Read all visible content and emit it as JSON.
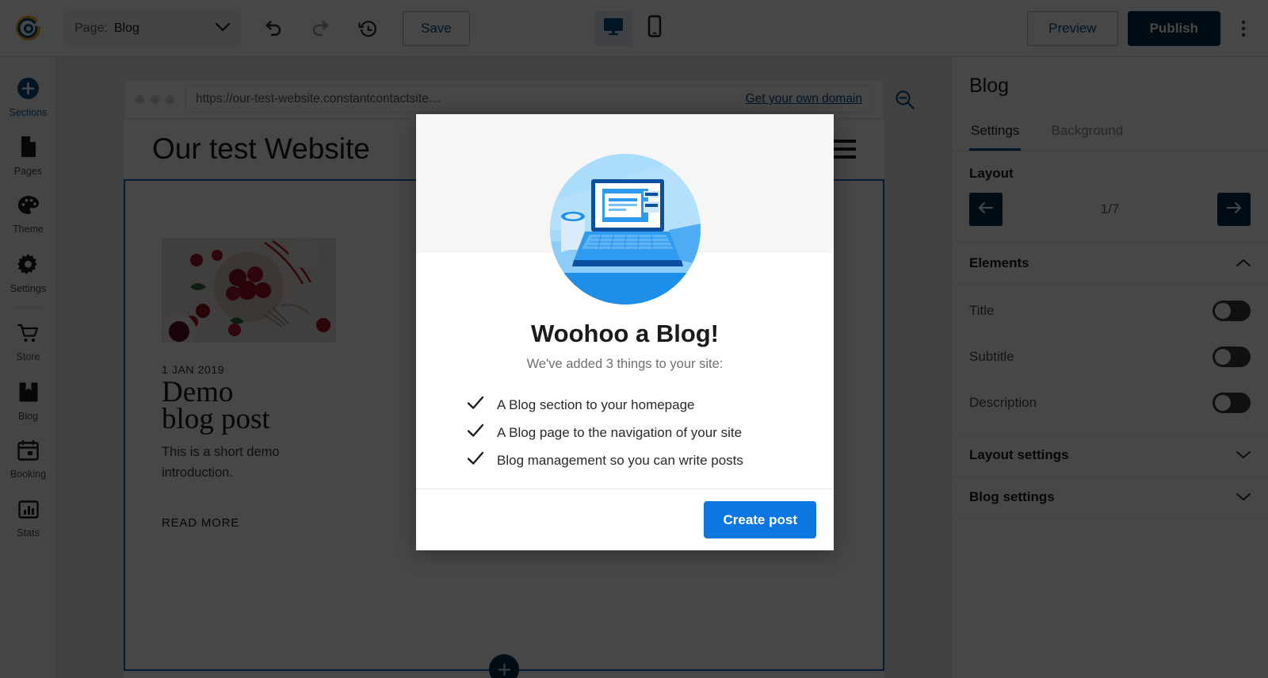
{
  "toolbar": {
    "logo_icon": "constant-contact-logo",
    "page_label": "Page:",
    "page_value": "Blog",
    "undo_icon": "undo-icon",
    "redo_icon": "redo-icon",
    "history_icon": "history-clock-icon",
    "save_label": "Save",
    "desktop_icon": "desktop-monitor-icon",
    "mobile_icon": "mobile-phone-icon",
    "preview_label": "Preview",
    "publish_label": "Publish",
    "kebab_icon": "more-options-icon"
  },
  "sidebar": {
    "items": [
      {
        "label": "Sections",
        "icon": "plus-circle-icon",
        "active": true
      },
      {
        "label": "Pages",
        "icon": "page-document-icon",
        "active": false
      },
      {
        "label": "Theme",
        "icon": "palette-icon",
        "active": false
      },
      {
        "label": "Settings",
        "icon": "gear-icon",
        "active": false
      },
      {
        "label": "Store",
        "icon": "shopping-cart-icon",
        "active": false
      },
      {
        "label": "Blog",
        "icon": "bookmark-book-icon",
        "active": false
      },
      {
        "label": "Booking",
        "icon": "calendar-icon",
        "active": false
      },
      {
        "label": "Stats",
        "icon": "bar-chart-icon",
        "active": false
      }
    ]
  },
  "canvas": {
    "browser": {
      "url": "https://our-test-website.constantcontactsite…",
      "domain_link": "Get your own domain",
      "zoom_icon": "zoom-out-magnifier-icon"
    },
    "site": {
      "title": "Our test Website",
      "menu_icon": "hamburger-menu-icon",
      "prev_arrow_icon": "chevron-left-icon",
      "next_arrow_icon": "chevron-right-icon",
      "posts": [
        {
          "date": "1 JAN 2019",
          "title_line1": "Demo",
          "title_line2": "blog post",
          "excerpt": "This is a short demo introduction.",
          "read_more": "READ MORE"
        }
      ]
    }
  },
  "right_panel": {
    "title": "Blog",
    "tabs": [
      {
        "label": "Settings",
        "active": true
      },
      {
        "label": "Background",
        "active": false
      }
    ],
    "layout": {
      "heading": "Layout",
      "value": "1/7",
      "prev_icon": "arrow-left-icon",
      "next_icon": "arrow-right-icon"
    },
    "elements": {
      "heading": "Elements",
      "collapse_icon": "chevron-up-icon",
      "rows": [
        {
          "label": "Title",
          "on": false
        },
        {
          "label": "Subtitle",
          "on": false
        },
        {
          "label": "Description",
          "on": false
        }
      ]
    },
    "sections": [
      {
        "label": "Layout settings",
        "icon": "chevron-down-icon"
      },
      {
        "label": "Blog settings",
        "icon": "chevron-down-icon"
      }
    ]
  },
  "modal": {
    "close_icon": "close-x-icon",
    "illustration": "laptop-with-coffee-illustration",
    "heading": "Woohoo a Blog!",
    "subheading": "We've added 3 things to your site:",
    "items": [
      "A Blog section to your homepage",
      "A Blog page to the navigation of your site",
      "Blog management so you can write posts"
    ],
    "check_icon": "checkmark-icon",
    "primary_button": "Create post"
  },
  "colors": {
    "brand_navy": "#0a2d4e",
    "link_blue": "#0a4c85",
    "primary_blue": "#0d76e0",
    "tab_underline": "#0a4c85",
    "selection_border": "#1565c0"
  }
}
